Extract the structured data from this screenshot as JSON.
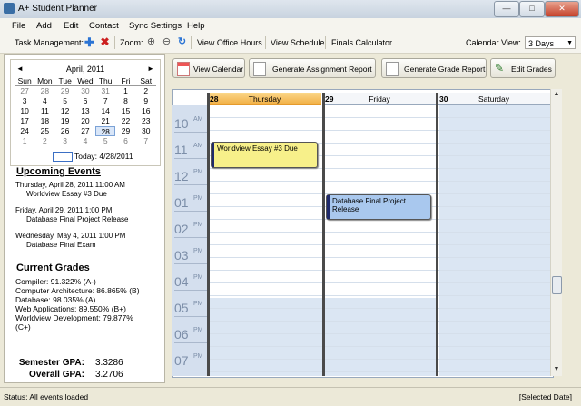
{
  "window": {
    "title": "A+ Student Planner",
    "min": "—",
    "max": "□",
    "close": "✕"
  },
  "menu": [
    "File",
    "Add",
    "Edit",
    "Contact",
    "Sync Settings",
    "Help"
  ],
  "toolbar": {
    "task_label": "Task Management:",
    "zoom_label": "Zoom:",
    "office_hours": "View Office Hours",
    "schedule": "View Schedule",
    "finals": "Finals Calculator",
    "calendar_view_label": "Calendar View:",
    "calendar_view_value": "3 Days"
  },
  "mini_calendar": {
    "prev": "◄",
    "next": "►",
    "month": "April, 2011",
    "weekdays": [
      "Sun",
      "Mon",
      "Tue",
      "Wed",
      "Thu",
      "Fri",
      "Sat"
    ],
    "weeks": [
      [
        "27",
        "28",
        "29",
        "30",
        "31",
        "1",
        "2"
      ],
      [
        "3",
        "4",
        "5",
        "6",
        "7",
        "8",
        "9"
      ],
      [
        "10",
        "11",
        "12",
        "13",
        "14",
        "15",
        "16"
      ],
      [
        "17",
        "18",
        "19",
        "20",
        "21",
        "22",
        "23"
      ],
      [
        "24",
        "25",
        "26",
        "27",
        "28",
        "29",
        "30"
      ],
      [
        "1",
        "2",
        "3",
        "4",
        "5",
        "6",
        "7"
      ]
    ],
    "today_text": "Today: 4/28/2011"
  },
  "upcoming": {
    "title": "Upcoming Events",
    "items": [
      {
        "when": "Thursday, April 28, 2011 11:00 AM",
        "what": "Worldview Essay #3 Due"
      },
      {
        "when": "Friday, April 29, 2011 1:00 PM",
        "what": "Database Final Project Release"
      },
      {
        "when": "Wednesday, May 4, 2011 1:00 PM",
        "what": "Database Final Exam"
      }
    ]
  },
  "grades": {
    "title": "Current Grades",
    "items": [
      "Compiler: 91.322% (A-)",
      "Computer Architecture: 86.865% (B)",
      "Database: 98.035% (A)",
      "Web Applications: 89.550% (B+)",
      "Worldview Development: 79.877%",
      "(C+)"
    ]
  },
  "gpa": {
    "semester_label": "Semester GPA:",
    "semester_value": "3.3286",
    "overall_label": "Overall GPA:",
    "overall_value": "3.2706"
  },
  "actions": {
    "view_calendar": "View Calendar",
    "assignment_report": "Generate Assignment Report",
    "grade_report": "Generate Grade Report",
    "edit_grades": "Edit Grades"
  },
  "days": [
    {
      "num": "28",
      "name": "Thursday"
    },
    {
      "num": "29",
      "name": "Friday"
    },
    {
      "num": "30",
      "name": "Saturday"
    }
  ],
  "hours": [
    {
      "h": "10",
      "ampm": "AM"
    },
    {
      "h": "11",
      "ampm": "AM"
    },
    {
      "h": "12",
      "ampm": "PM"
    },
    {
      "h": "01",
      "ampm": "PM"
    },
    {
      "h": "02",
      "ampm": "PM"
    },
    {
      "h": "03",
      "ampm": "PM"
    },
    {
      "h": "04",
      "ampm": "PM"
    },
    {
      "h": "05",
      "ampm": "PM"
    },
    {
      "h": "06",
      "ampm": "PM"
    },
    {
      "h": "07",
      "ampm": "PM"
    }
  ],
  "events": [
    {
      "title": "Worldview Essay #3 Due",
      "color": "#f7f08a"
    },
    {
      "title": "Database Final Project Release",
      "color": "#a9c8ee"
    }
  ],
  "status": {
    "left": "Status: All events loaded",
    "right": "[Selected Date]"
  },
  "colors": {
    "today_header": "#f2b24a",
    "time_column": "#d4dfee",
    "off_hours": "#dbe6f3"
  }
}
